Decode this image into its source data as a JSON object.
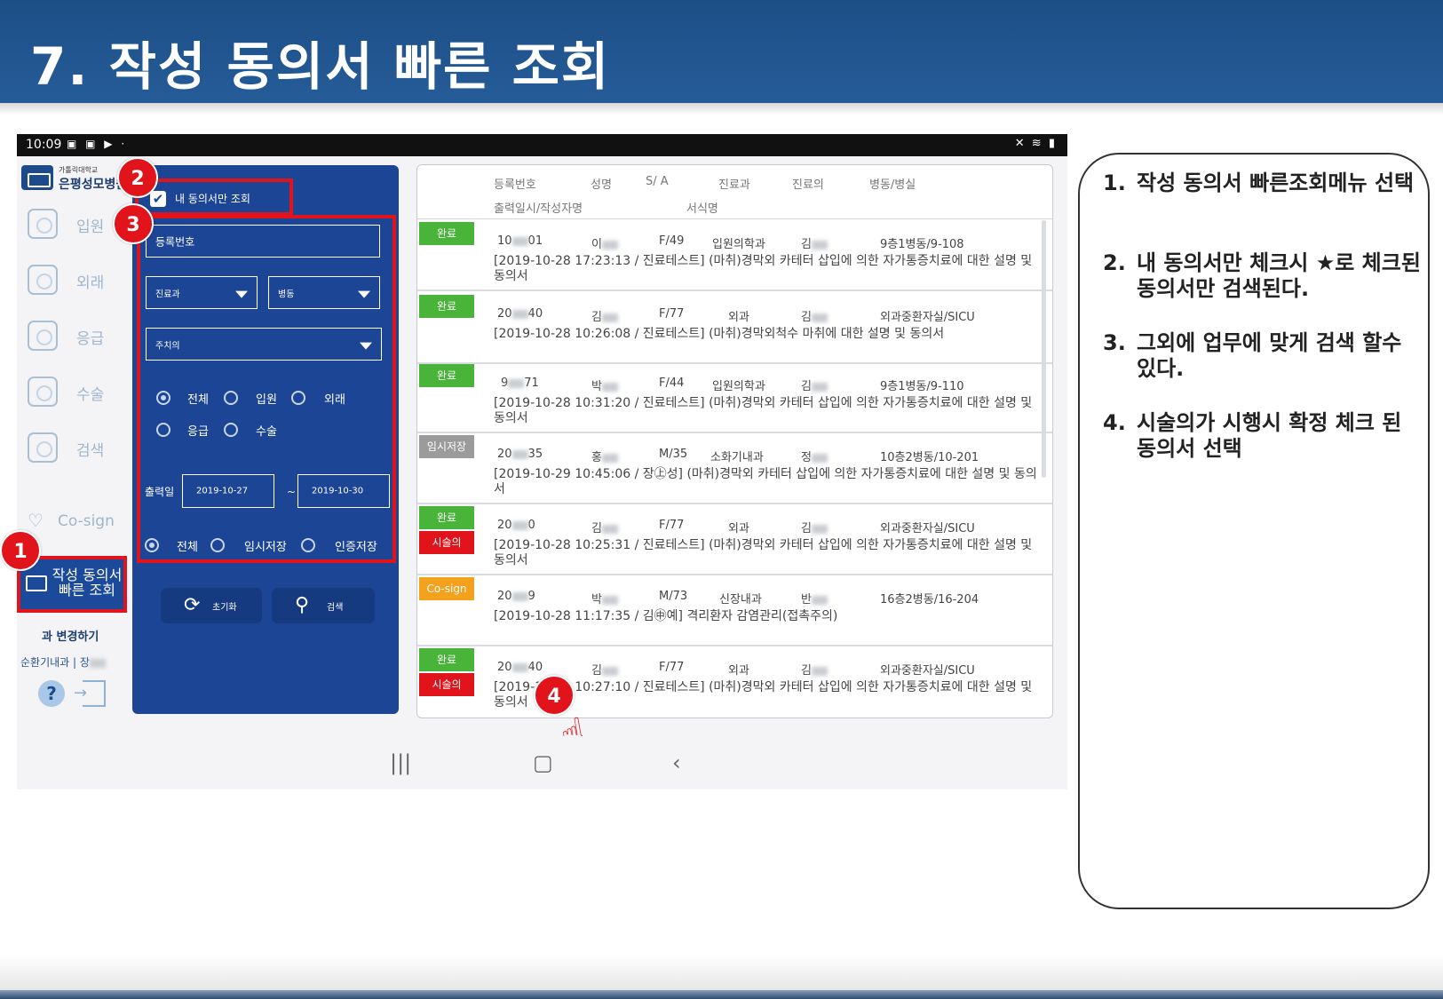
{
  "slide": {
    "title": "7. 작성 동의서 빠른 조회"
  },
  "status_bar": {
    "time": "10:09",
    "left_icons": "▣ ▣ ▶ ·",
    "right_icons": "✕ ≋ ▮"
  },
  "nav": {
    "logo_small": "가톨릭대학교",
    "logo_name": "은평성모병원",
    "items": [
      {
        "label": "입원",
        "icon": "inpatient-icon"
      },
      {
        "label": "외래",
        "icon": "outpatient-icon"
      },
      {
        "label": "응급",
        "icon": "ambulance-icon"
      },
      {
        "label": "수술",
        "icon": "surgery-icon"
      },
      {
        "label": "검색",
        "icon": "search-icon"
      }
    ],
    "cosign_label": "Co-sign",
    "active_label": "작성 동의서 빠른 조회",
    "dept_change": "과 변경하기",
    "user_dept": "순환기내과 | 장",
    "help_glyph": "?"
  },
  "search": {
    "my_only_label": "내 동의서만 조회",
    "reg_no_placeholder": "등록번호",
    "dept_select": "진료과",
    "ward_select": "병동",
    "doctor_select": "주치의",
    "visit_types": [
      "전체",
      "입원",
      "외래",
      "응급",
      "수술"
    ],
    "date_label": "출력일",
    "date_from": "2019-10-27",
    "date_sep": "~",
    "date_to": "2019-10-30",
    "save_types": [
      "전체",
      "임시저장",
      "인증저장"
    ],
    "reset_label": "초기화",
    "search_label": "검색"
  },
  "list": {
    "headers": {
      "reg_no": "등록번호",
      "name": "성명",
      "sa": "S/ A",
      "dept": "진료과",
      "doctor": "진료의",
      "ward": "병동/병실",
      "printed": "출력일시/작성자명",
      "form": "서식명"
    },
    "rows": [
      {
        "tags": [
          "완료"
        ],
        "reg": "10",
        "reg2": "01",
        "name": "이",
        "sa": "F/49",
        "dept": "입원의학과",
        "doc": "김",
        "ward": "9층1병동/9-108",
        "desc": "[2019-10-28 17:23:13 / 진료테스트] (마취)경막외 카테터 삽입에 의한 자가통증치료에 대한 설명 및 동의서"
      },
      {
        "tags": [
          "완료"
        ],
        "reg": "20",
        "reg2": "40",
        "name": "김",
        "sa": "F/77",
        "dept": "외과",
        "doc": "김",
        "ward": "외과중환자실/SICU",
        "desc": "[2019-10-28 10:26:08 / 진료테스트] (마취)경막외척수 마취에 대한 설명 및 동의서"
      },
      {
        "tags": [
          "완료"
        ],
        "reg": "9",
        "reg2": "71",
        "name": "박",
        "sa": "F/44",
        "dept": "입원의학과",
        "doc": "김",
        "ward": "9층1병동/9-110",
        "desc": "[2019-10-28 10:31:20 / 진료테스트] (마취)경막외 카테터 삽입에 의한 자가통증치료에 대한 설명 및 동의서"
      },
      {
        "tags": [
          "임시저장"
        ],
        "reg": "20",
        "reg2": "35",
        "name": "홍",
        "sa": "M/35",
        "dept": "소화기내과",
        "doc": "정",
        "ward": "10층2병동/10-201",
        "desc": "[2019-10-29 10:45:06 / 장㊤성] (마취)경막외 카테터 삽입에 의한 자가통증치료에 대한 설명 및 동의서"
      },
      {
        "tags": [
          "완료",
          "시술의"
        ],
        "reg": "20",
        "reg2": "0",
        "name": "김",
        "sa": "F/77",
        "dept": "외과",
        "doc": "김",
        "ward": "외과중환자실/SICU",
        "desc": "[2019-10-28 10:25:31 / 진료테스트] (마취)경막외 카테터 삽입에 의한 자가통증치료에 대한 설명 및 동의서"
      },
      {
        "tags": [
          "Co-sign"
        ],
        "reg": "20",
        "reg2": "9",
        "name": "박",
        "sa": "M/73",
        "dept": "신장내과",
        "doc": "반",
        "ward": "16층2병동/16-204",
        "desc": "[2019-10-28 11:17:35 / 김㊥예] 격리환자 감염관리(접촉주의)"
      },
      {
        "tags": [
          "완료",
          "시술의"
        ],
        "reg": "20",
        "reg2": "40",
        "name": "김",
        "sa": "F/77",
        "dept": "외과",
        "doc": "김",
        "ward": "외과중환자실/SICU",
        "desc": "[2019-10-28 10:27:10 / 진료테스트] (마취)경막외 카테터 삽입에 의한 자가통증치료에 대한 설명 및 동의서"
      }
    ]
  },
  "markers": [
    "1",
    "2",
    "3",
    "4"
  ],
  "instructions": [
    {
      "num": "1.",
      "text": "작성 동의서 빠른조회메뉴 선택"
    },
    {
      "num": "2.",
      "text": "내 동의서만 체크시 ★로 체크된 동의서만 검색된다."
    },
    {
      "num": "3.",
      "text": "그외에 업무에 맞게 검색 할수 있다."
    },
    {
      "num": "4.",
      "text": "시술의가 시행시 확정 체크 된 동의서 선택"
    }
  ],
  "colors": {
    "header": "#1d4e86",
    "panel": "#1d4595",
    "highlight": "#e1131b",
    "done": "#4ab339",
    "cosign": "#f4a11e",
    "temp": "#9b9b9b"
  }
}
